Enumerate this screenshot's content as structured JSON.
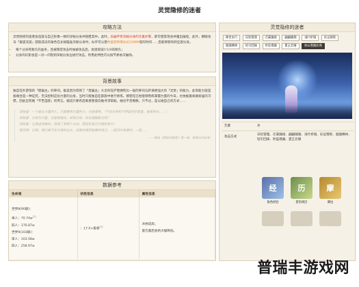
{
  "page": {
    "title": "灵觉隐修的迷者"
  },
  "strategy": {
    "header": "攻略方法",
    "p1_a": "灵觉隐修的迷者会选就与自己形象一致的深秘分身并隐匿其中。此时，",
    "p1_red": "去破坏有深秘分身的元素护罩",
    "p1_b": "，即可使其现身并露出破绽。此外，狮眼龙马「报波流波」部族成员的角色在长按瞄准深秘分身时，似乎可以使",
    "p1_orange": "共鉴智师增长达15899",
    "p1_c": "倍的时间……且能够影响到全部分身。",
    "bullet1": "每个分身有耐久的血条，且被锁定攻击时候被攻击后，会逐渐减少1/4的耐久；",
    "bullet2": "分身的幻影会是一对一闪现到深秘分身边进行攻击，利用此特性可以按节奏依次破除。"
  },
  "story": {
    "header": "背景故事",
    "text": "独自在外游荡的「煌骗主」的祭司。据说因为得到了「煌骗主」大灵的在庐而拥有比一般的祭司与萨满更强大的「灵觉」的能力，此等能力就是极端合是一种证究，无法控制这份力量的分身，当时只能独自在部族中进行修炼。那使在已经能够熟练掌握力量的今日，也依据着离群索居的习惯，因此出有她「不苦自醉」的传言。据说只要有后来者愿意向她寻求帮助，她也不吝赐教。只不过，是以她自己的方式……",
    "quote1": "深秘者：一个能长力量的人，只是使用力量的力，也是使用，「不说分身和不停留在在家里，是某的光……」",
    "quote2": "深秘者：分身为力量，它能够强化，却很分体，你在理解能力吗？",
    "quote3": "深秘者：让我这样做你，就成了有哪个方向，而就在自己为我的身分！",
    "quote4": "我觉得：记得，我们是不会为我的全文，就像你我后面要的自己，一起见时来看你，一起……",
    "quote_source": "——摘自《悠弦的秘意》第一卷，就原以内未知"
  },
  "data_ref": {
    "header": "数据参考",
    "col1": "生命值",
    "col2": "抗性信息",
    "col3": "属性信息",
    "hp_lines": [
      "世界8(90级)：",
      "单人：70.74w",
      "四人：176.87w",
      "世界9(103级)：",
      "单人：103.58w",
      "四人：258.97w"
    ],
    "sup_mark": "[1]",
    "res": "：17.0×香香",
    "res_sup": "[2]",
    "attr_l1": "冰抗较高；",
    "attr_l2": "嵌元素后会抗大幅降低。"
  },
  "right": {
    "header": "灵觉隐修的迷者",
    "tags": [
      "降世水行",
      "日轮管理",
      "迁豪踊接",
      "翩翩踊翘",
      "浅叶折缝",
      "彩远锦卷",
      "烟烟棵林",
      "轻引回锋",
      "吹笙嗫踊",
      "夏王云曜",
      "孙大川"
    ],
    "active_tag": "你山雪烟彩燕",
    "info": [
      {
        "k": "元素",
        "v": "冰"
      },
      {
        "k": "攻击方式",
        "v": "日轮管理、迁豪踊接、翩翩踊翘、浅叶折缝、彩远锦卷、烟烟棵林、轻引回锋、吹笙嗫踊、夏王云曜"
      }
    ],
    "icons": [
      {
        "label": "角色经验",
        "glyph": "经"
      },
      {
        "label": "冒险阅历",
        "glyph": "历"
      },
      {
        "label": "摩拉",
        "glyph": "摩"
      }
    ]
  },
  "watermark": "普瑞丰游戏网"
}
